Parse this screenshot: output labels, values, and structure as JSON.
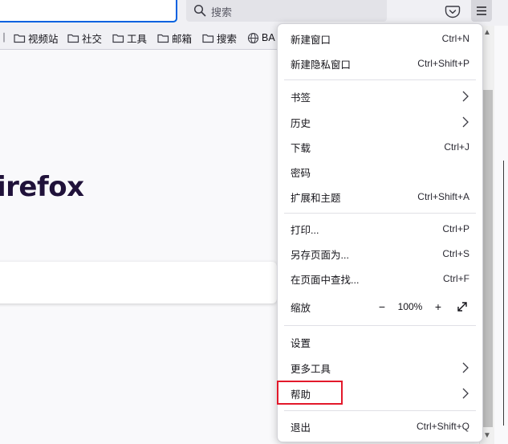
{
  "toolbar": {
    "search_placeholder": "搜索",
    "search_icon": "magnifier-icon",
    "pocket_icon": "pocket-icon",
    "menu_icon": "hamburger-icon"
  },
  "bookmarks": [
    {
      "label": "视频站",
      "icon": "folder-icon"
    },
    {
      "label": "社交",
      "icon": "folder-icon"
    },
    {
      "label": "工具",
      "icon": "folder-icon"
    },
    {
      "label": "邮箱",
      "icon": "folder-icon"
    },
    {
      "label": "搜索",
      "icon": "folder-icon"
    },
    {
      "label": "BA",
      "icon": "globe-icon"
    }
  ],
  "page": {
    "brand_text": "irefox"
  },
  "menu": {
    "new_window": {
      "label": "新建窗口",
      "shortcut": "Ctrl+N"
    },
    "new_private": {
      "label": "新建隐私窗口",
      "shortcut": "Ctrl+Shift+P"
    },
    "bookmarks": {
      "label": "书签"
    },
    "history": {
      "label": "历史"
    },
    "downloads": {
      "label": "下载",
      "shortcut": "Ctrl+J"
    },
    "passwords": {
      "label": "密码"
    },
    "addons": {
      "label": "扩展和主题",
      "shortcut": "Ctrl+Shift+A"
    },
    "print": {
      "label": "打印...",
      "shortcut": "Ctrl+P"
    },
    "save_page": {
      "label": "另存页面为...",
      "shortcut": "Ctrl+S"
    },
    "find": {
      "label": "在页面中查找...",
      "shortcut": "Ctrl+F"
    },
    "zoom": {
      "label": "缩放",
      "minus": "−",
      "value": "100%",
      "plus": "+"
    },
    "settings": {
      "label": "设置"
    },
    "more_tools": {
      "label": "更多工具"
    },
    "help": {
      "label": "帮助"
    },
    "quit": {
      "label": "退出",
      "shortcut": "Ctrl+Shift+Q"
    }
  },
  "colors": {
    "highlight_box": "#e3192b",
    "url_focus": "#0061e0",
    "brand": "#20123a"
  }
}
